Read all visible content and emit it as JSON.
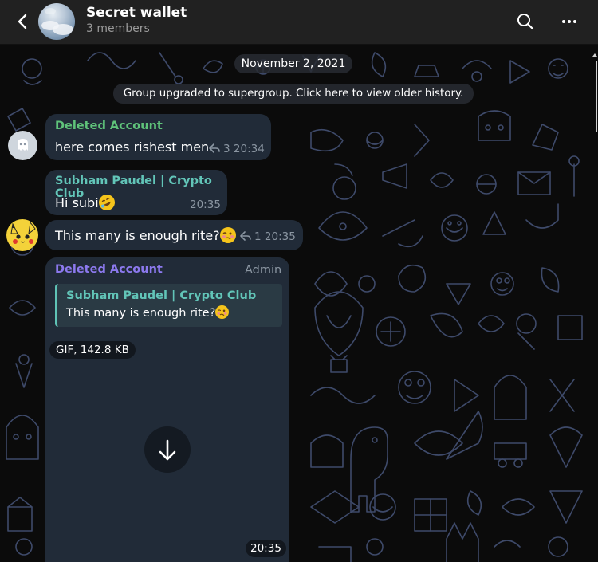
{
  "header": {
    "title": "Secret wallet",
    "subtitle": "3 members"
  },
  "chat": {
    "date": "November 2, 2021",
    "service_message": "Group upgraded to supergroup. Click here to view older history.",
    "messages": [
      {
        "sender": "Deleted Account",
        "text": "here comes rishest men",
        "replies": "3",
        "time": "20:34"
      },
      {
        "sender": "Subham Paudel | Crypto Club",
        "text": "Hi subi",
        "emoji": "rolling-on-floor-laughing",
        "time": "20:35"
      },
      {
        "text": "This many is enough rite?",
        "emoji": "woozy-face",
        "replies": "1",
        "time": "20:35"
      },
      {
        "sender": "Deleted Account",
        "role": "Admin",
        "reply_to": {
          "sender": "Subham Paudel | Crypto Club",
          "text": "This many is enough rite?"
        },
        "media": "GIF, 142.8 KB",
        "time": "20:35"
      }
    ]
  },
  "colors": {
    "header_bg": "#212121",
    "bubble_bg": "#212b38",
    "green_name": "#5fc37a",
    "teal_name": "#62c5b8",
    "violet_name": "#8c79ee",
    "pattern": "#3e4a6a"
  },
  "icons": {
    "back": "chevron-left-icon",
    "search": "search-icon",
    "more": "more-horizontal-icon",
    "reply": "reply-arrow-icon",
    "download": "download-arrow-icon"
  }
}
